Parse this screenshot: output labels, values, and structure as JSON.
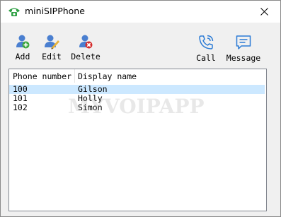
{
  "window": {
    "title": "miniSIPPhone",
    "icon": "green-phone-icon",
    "close_icon": "close-icon"
  },
  "toolbar": {
    "add_label": "Add",
    "edit_label": "Edit",
    "delete_label": "Delete",
    "call_label": "Call",
    "message_label": "Message"
  },
  "contacts": {
    "columns": [
      "Phone number",
      "Display name"
    ],
    "rows": [
      {
        "phone": "100",
        "name": "Gilson",
        "selected": true
      },
      {
        "phone": "101",
        "name": "Holly",
        "selected": false
      },
      {
        "phone": "102",
        "name": "Simon",
        "selected": false
      }
    ]
  },
  "watermark": "MYVOIPAPP",
  "colors": {
    "selection": "#cce8ff",
    "accent_blue": "#2a7ad5",
    "add_green": "#3aa63a",
    "delete_red": "#d42a2a"
  }
}
